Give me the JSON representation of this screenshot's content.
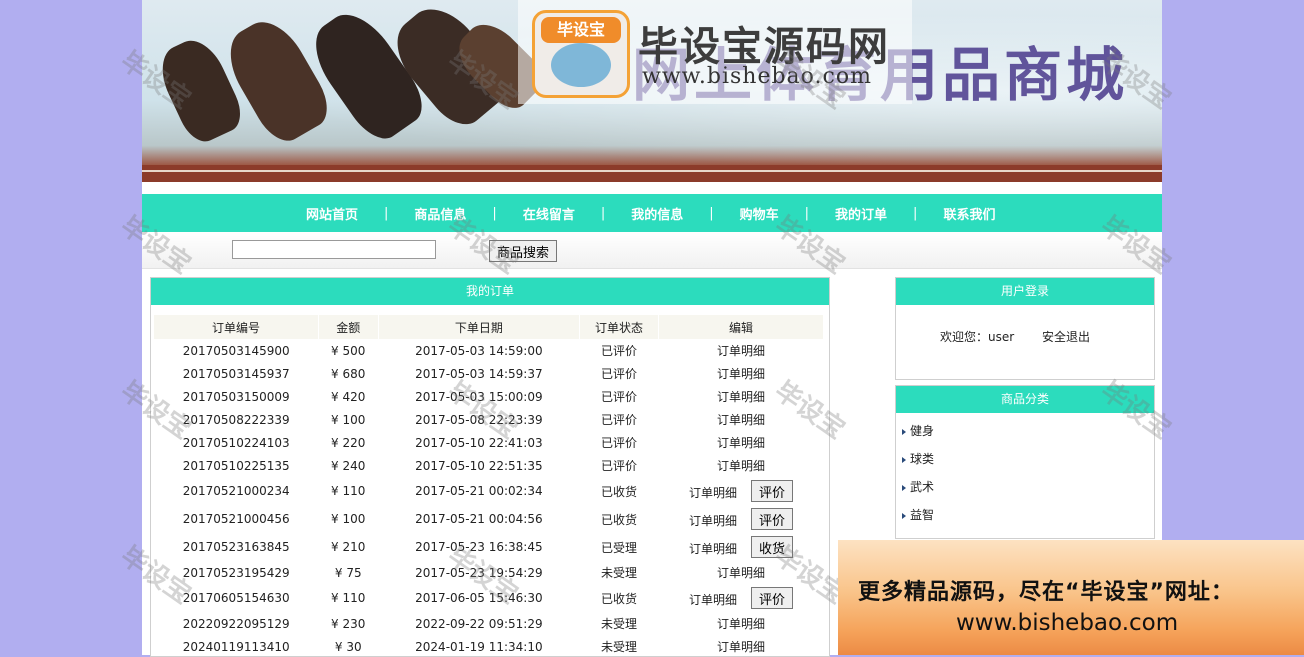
{
  "banner": {
    "site_title": "网上体育用品商城",
    "logo_name": "毕设宝源码网",
    "logo_url": "www.bishebao.com",
    "logo_badge": "毕设宝"
  },
  "nav": {
    "items": [
      "网站首页",
      "商品信息",
      "在线留言",
      "我的信息",
      "购物车",
      "我的订单",
      "联系我们"
    ],
    "separator": "|"
  },
  "search": {
    "input_value": "",
    "button_label": "商品搜索"
  },
  "orders": {
    "title": "我的订单",
    "columns": [
      "订单编号",
      "金额",
      "下单日期",
      "订单状态",
      "编辑"
    ],
    "rows": [
      {
        "id": "20170503145900",
        "amount": "¥ 500",
        "date": "2017-05-03 14:59:00",
        "status": "已评价",
        "detail": "订单明细",
        "action": ""
      },
      {
        "id": "20170503145937",
        "amount": "¥ 680",
        "date": "2017-05-03 14:59:37",
        "status": "已评价",
        "detail": "订单明细",
        "action": ""
      },
      {
        "id": "20170503150009",
        "amount": "¥ 420",
        "date": "2017-05-03 15:00:09",
        "status": "已评价",
        "detail": "订单明细",
        "action": ""
      },
      {
        "id": "20170508222339",
        "amount": "¥ 100",
        "date": "2017-05-08 22:23:39",
        "status": "已评价",
        "detail": "订单明细",
        "action": ""
      },
      {
        "id": "20170510224103",
        "amount": "¥ 220",
        "date": "2017-05-10 22:41:03",
        "status": "已评价",
        "detail": "订单明细",
        "action": ""
      },
      {
        "id": "20170510225135",
        "amount": "¥ 240",
        "date": "2017-05-10 22:51:35",
        "status": "已评价",
        "detail": "订单明细",
        "action": ""
      },
      {
        "id": "20170521000234",
        "amount": "¥ 110",
        "date": "2017-05-21 00:02:34",
        "status": "已收货",
        "detail": "订单明细",
        "action": "评价"
      },
      {
        "id": "20170521000456",
        "amount": "¥ 100",
        "date": "2017-05-21 00:04:56",
        "status": "已收货",
        "detail": "订单明细",
        "action": "评价"
      },
      {
        "id": "20170523163845",
        "amount": "¥ 210",
        "date": "2017-05-23 16:38:45",
        "status": "已受理",
        "detail": "订单明细",
        "action": "收货"
      },
      {
        "id": "20170523195429",
        "amount": "¥ 75",
        "date": "2017-05-23 19:54:29",
        "status": "未受理",
        "detail": "订单明细",
        "action": ""
      },
      {
        "id": "20170605154630",
        "amount": "¥ 110",
        "date": "2017-06-05 15:46:30",
        "status": "已收货",
        "detail": "订单明细",
        "action": "评价"
      },
      {
        "id": "20220922095129",
        "amount": "¥ 230",
        "date": "2022-09-22 09:51:29",
        "status": "未受理",
        "detail": "订单明细",
        "action": ""
      },
      {
        "id": "20240119113410",
        "amount": "¥ 30",
        "date": "2024-01-19 11:34:10",
        "status": "未受理",
        "detail": "订单明细",
        "action": ""
      }
    ]
  },
  "login": {
    "title": "用户登录",
    "welcome": "欢迎您：user",
    "logout": "安全退出"
  },
  "categories": {
    "title": "商品分类",
    "items": [
      "健身",
      "球类",
      "武术",
      "益智"
    ]
  },
  "watermark": "毕设宝",
  "ad": {
    "line1": "更多精品源码，尽在“毕设宝”网址：",
    "line2": "www.bishebao.com"
  },
  "colors": {
    "accent": "#2cdcbd",
    "background": "#b1aef0"
  }
}
